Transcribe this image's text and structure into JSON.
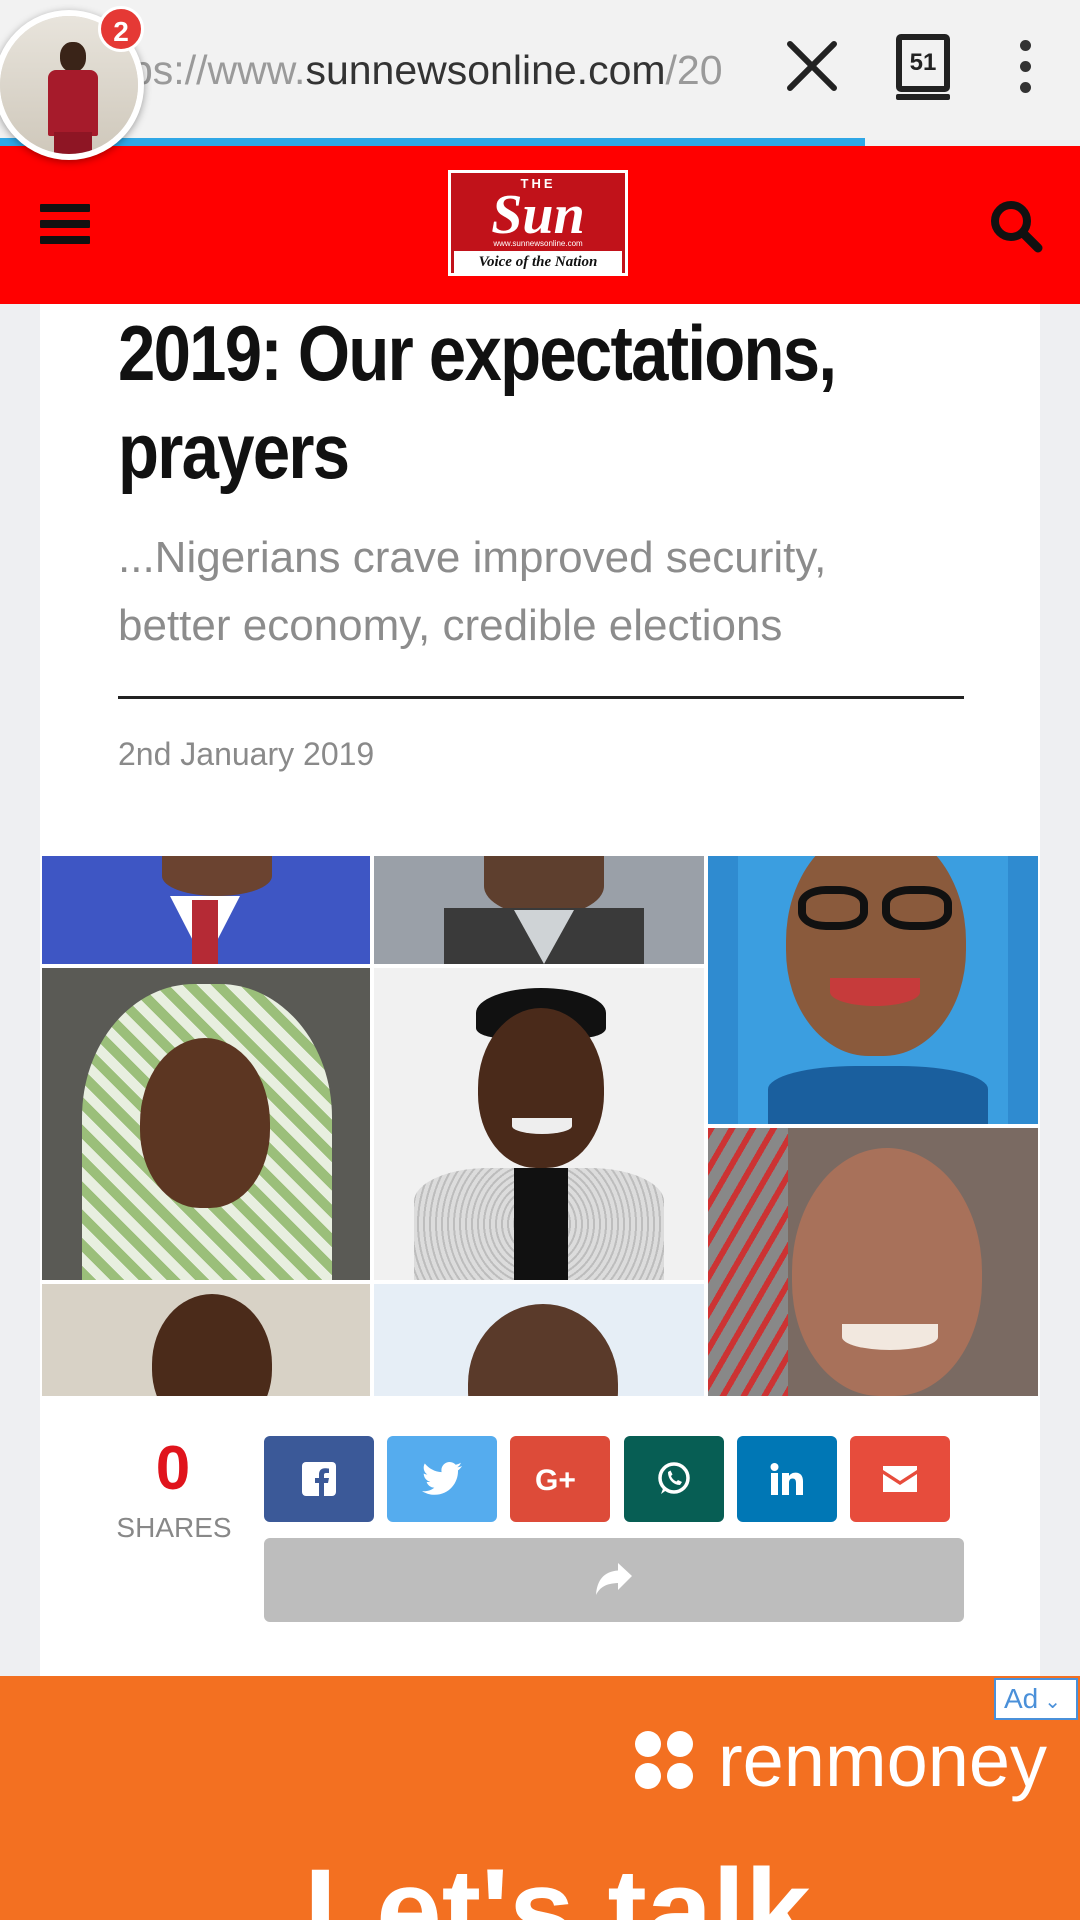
{
  "browser": {
    "url_prefix": "ps://www.",
    "url_domain": "sunnewsonline.com",
    "url_rest": "/20",
    "tab_count": "51",
    "notification_count": "2"
  },
  "site": {
    "logo_top": "THE",
    "logo_main": "Sun",
    "logo_url": "www.sunnewsonline.com",
    "logo_tagline": "Voice of the Nation"
  },
  "article": {
    "title": "2019: Our expectations, prayers",
    "subtitle": "...Nigerians crave improved security, better economy, credible elections",
    "date": "2nd January 2019"
  },
  "share": {
    "count": "0",
    "label": "SHARES",
    "buttons": [
      {
        "name": "facebook",
        "color": "#3b5998"
      },
      {
        "name": "twitter",
        "color": "#55acee"
      },
      {
        "name": "google-plus",
        "color": "#dd4b39"
      },
      {
        "name": "whatsapp",
        "color": "#075e54"
      },
      {
        "name": "linkedin",
        "color": "#0077b5"
      },
      {
        "name": "email",
        "color": "#e74c3c"
      }
    ]
  },
  "ad": {
    "choice_label": "Ad",
    "brand": "renmoney",
    "headline": "Let's talk",
    "background": "#f37021"
  }
}
